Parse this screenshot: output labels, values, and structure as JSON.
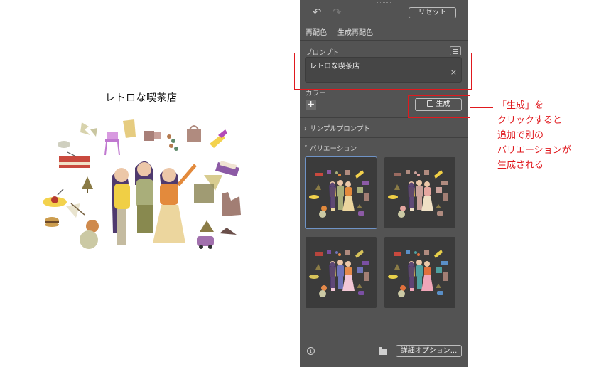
{
  "artboard": {
    "title": "レトロな喫茶店"
  },
  "panel": {
    "toolbar": {
      "undo_icon": "undo-icon",
      "redo_icon": "redo-icon",
      "reset_label": "リセット"
    },
    "tabs": [
      {
        "label": "再配色",
        "active": false
      },
      {
        "label": "生成再配色",
        "active": true
      }
    ],
    "prompt": {
      "label": "プロンプト",
      "value": "レトロな喫茶店",
      "clear_icon": "×"
    },
    "color": {
      "label": "カラー",
      "add_icon": "+"
    },
    "generate": {
      "label": "生成"
    },
    "sample_prompts": {
      "label": "サンプルプロンプト",
      "expanded": false
    },
    "variations": {
      "label": "バリエーション",
      "expanded": true,
      "count": 4,
      "selected_index": 0
    },
    "footer": {
      "advanced_label": "詳細オプション..."
    }
  },
  "annotation": {
    "color": "#e0191e",
    "lines": [
      "「生成」を",
      "クリックすると",
      "追加で別の",
      "バリエーションが",
      "生成される"
    ]
  }
}
